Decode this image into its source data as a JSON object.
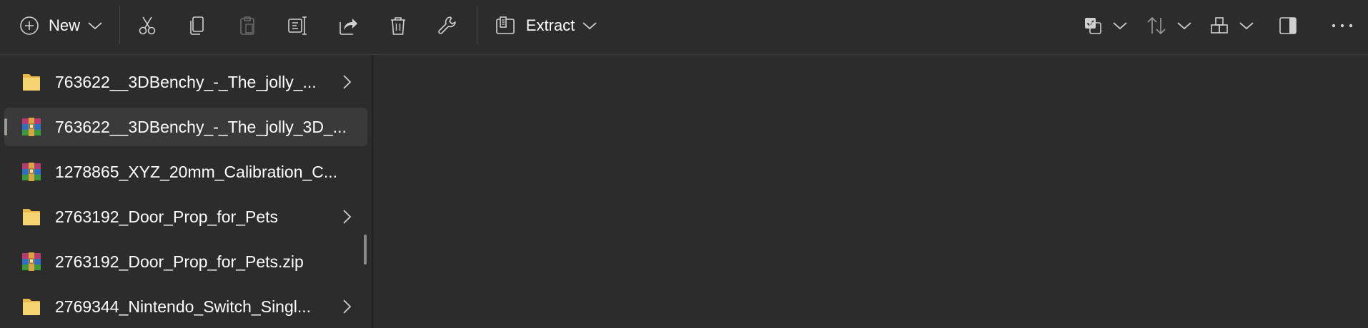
{
  "toolbar": {
    "new_label": "New",
    "extract_label": "Extract",
    "buttons": [
      {
        "name": "cut-icon",
        "enabled": true
      },
      {
        "name": "copy-icon",
        "enabled": true
      },
      {
        "name": "paste-icon",
        "enabled": false
      },
      {
        "name": "rename-icon",
        "enabled": true
      },
      {
        "name": "share-icon",
        "enabled": true
      },
      {
        "name": "delete-icon",
        "enabled": true
      },
      {
        "name": "properties-wrench-icon",
        "enabled": true
      }
    ],
    "right_buttons": [
      "select-icon",
      "sort-icon",
      "view-layout-icon",
      "details-pane-icon",
      "more-options-icon"
    ]
  },
  "nav": {
    "items": [
      {
        "label": "763622__3DBenchy_-_The_jolly_...",
        "type": "folder",
        "expandable": true,
        "selected": false
      },
      {
        "label": "763622__3DBenchy_-_The_jolly_3D_...",
        "type": "archive",
        "expandable": false,
        "selected": true
      },
      {
        "label": "1278865_XYZ_20mm_Calibration_C...",
        "type": "archive",
        "expandable": false,
        "selected": false
      },
      {
        "label": "2763192_Door_Prop_for_Pets",
        "type": "folder",
        "expandable": true,
        "selected": false
      },
      {
        "label": "2763192_Door_Prop_for_Pets.zip",
        "type": "archive",
        "expandable": false,
        "selected": false
      },
      {
        "label": "2769344_Nintendo_Switch_Singl...",
        "type": "folder",
        "expandable": true,
        "selected": false
      }
    ]
  }
}
